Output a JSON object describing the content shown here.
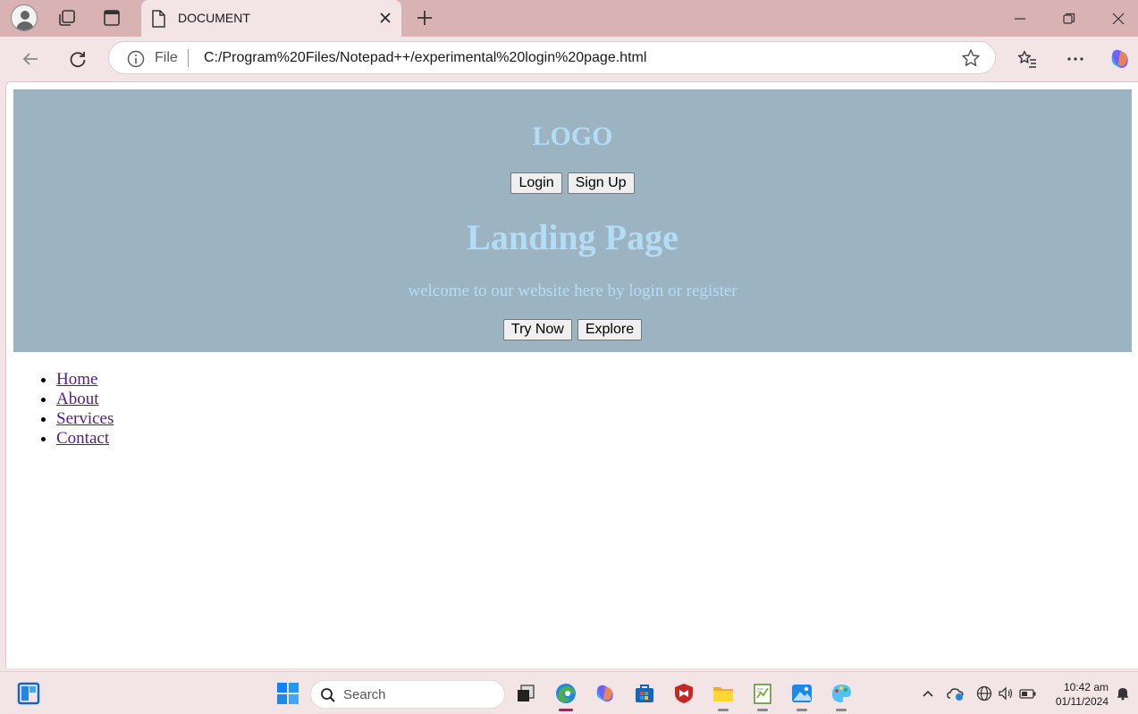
{
  "browser": {
    "tab_title": "DOCUMENT",
    "address_scheme": "File",
    "address_url": "C:/Program%20Files/Notepad++/experimental%20login%20page.html"
  },
  "page": {
    "logo": "LOGO",
    "login_label": "Login",
    "signup_label": "Sign Up",
    "heading": "Landing Page",
    "subtitle": "welcome to our website here by login or register",
    "try_label": "Try Now",
    "explore_label": "Explore",
    "hero_bg": "#9cb4c2",
    "hero_text_color": "#b3dcf5",
    "nav": [
      "Home",
      "About",
      "Services",
      "Contact"
    ]
  },
  "taskbar": {
    "search_placeholder": "Search",
    "time": "10:42 am",
    "date": "01/11/2024",
    "apps": [
      "start-icon",
      "task-view-icon",
      "edge-icon",
      "copilot-icon",
      "store-icon",
      "mcafee-icon",
      "file-explorer-icon",
      "notepad-plus-plus-icon",
      "photos-icon",
      "paint-icon"
    ]
  }
}
